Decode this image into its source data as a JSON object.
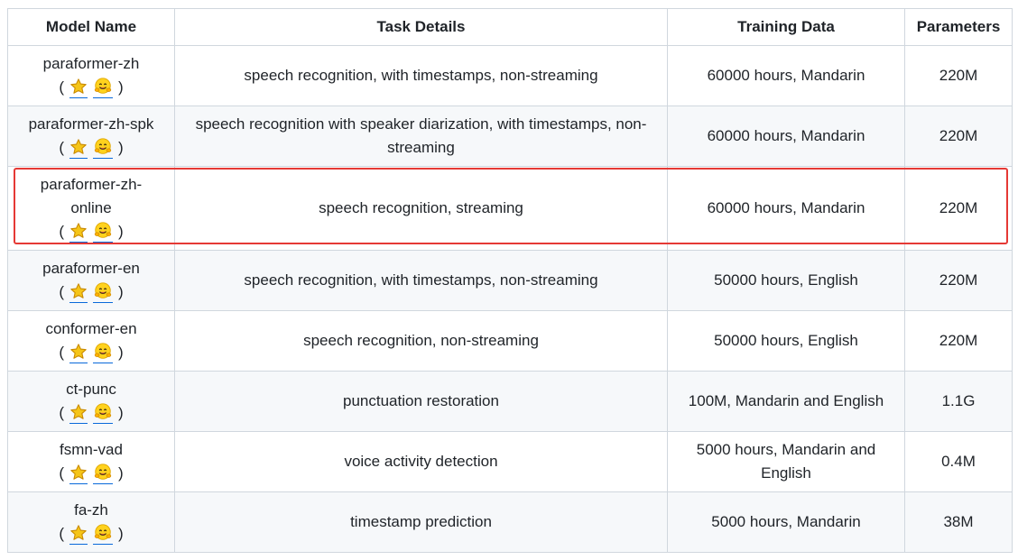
{
  "table": {
    "headers": [
      "Model Name",
      "Task Details",
      "Training Data",
      "Parameters"
    ],
    "icons": {
      "open_paren": "(",
      "close_paren": ")",
      "star_icon": "star-icon",
      "hug_icon": "hugging-face-icon",
      "star_color": "#f5c518",
      "hug_color": "#ffd21e"
    },
    "rows": [
      {
        "model": "paraformer-zh",
        "task": "speech recognition, with timestamps, non-streaming",
        "data": "60000 hours, Mandarin",
        "params": "220M"
      },
      {
        "model": "paraformer-zh-spk",
        "task": "speech recognition with speaker diarization, with timestamps, non-streaming",
        "data": "60000 hours, Mandarin",
        "params": "220M"
      },
      {
        "model": "paraformer-zh-online",
        "task": "speech recognition, streaming",
        "data": "60000 hours, Mandarin",
        "params": "220M",
        "highlighted": true
      },
      {
        "model": "paraformer-en",
        "task": "speech recognition, with timestamps, non-streaming",
        "data": "50000 hours, English",
        "params": "220M"
      },
      {
        "model": "conformer-en",
        "task": "speech recognition, non-streaming",
        "data": "50000 hours, English",
        "params": "220M"
      },
      {
        "model": "ct-punc",
        "task": "punctuation restoration",
        "data": "100M, Mandarin and English",
        "params": "1.1G"
      },
      {
        "model": "fsmn-vad",
        "task": "voice activity detection",
        "data": "5000 hours, Mandarin and English",
        "params": "0.4M"
      },
      {
        "model": "fa-zh",
        "task": "timestamp prediction",
        "data": "5000 hours, Mandarin",
        "params": "38M"
      }
    ]
  },
  "colors": {
    "border": "#d0d7de",
    "stripe": "#f6f8fa",
    "highlight": "#e53935",
    "link": "#0969da"
  }
}
